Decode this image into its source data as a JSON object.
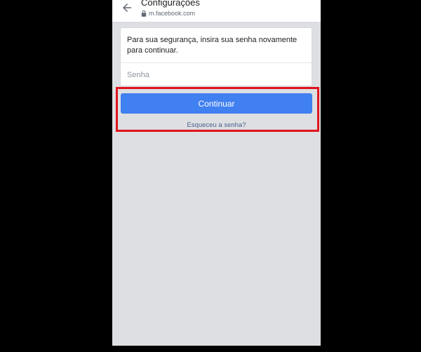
{
  "header": {
    "title": "Configurações",
    "url": "m.facebook.com",
    "back_icon": "arrow-left-icon",
    "lock_icon": "lock-icon"
  },
  "form": {
    "message": "Para sua segurança, insira sua senha novamente para continuar.",
    "password_placeholder": "Senha",
    "password_value": "",
    "continue_label": "Continuar",
    "forgot_label": "Esqueceu a senha?"
  },
  "colors": {
    "primary_button": "#4080f0",
    "highlight_border": "#e0141d",
    "page_background": "#dddfe2",
    "link": "#4b5f8d"
  }
}
